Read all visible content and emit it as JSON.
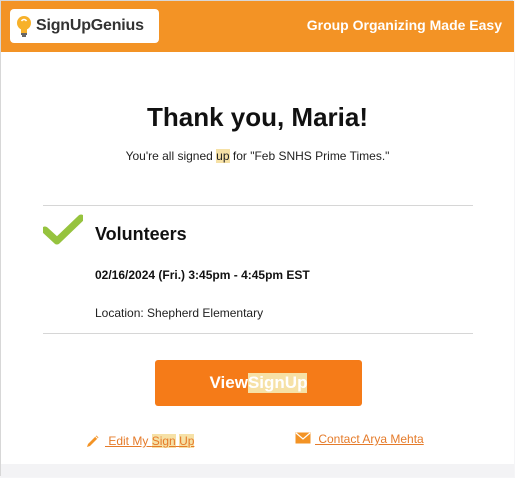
{
  "header": {
    "brand": "SignUpGenius",
    "tagline": "Group Organizing Made Easy"
  },
  "confirmation": {
    "title": "Thank you, Maria!",
    "subtitle_before": "You're all signed ",
    "subtitle_highlight": "up",
    "subtitle_after": " for \"Feb SNHS Prime Times.\""
  },
  "slot": {
    "name": "Volunteers",
    "datetime": "02/16/2024 (Fri.) 3:45pm - 4:45pm EST",
    "location": "Location: Shepherd Elementary"
  },
  "actions": {
    "view_prefix": "View ",
    "view_highlight_1": "Sign",
    "view_space": " ",
    "view_highlight_2": "Up",
    "edit_prefix": " Edit My ",
    "edit_highlight_1": "Sign",
    "edit_space": " ",
    "edit_highlight_2": "Up",
    "contact": " Contact Arya Mehta"
  },
  "colors": {
    "brand_orange": "#f39325",
    "button_orange": "#f57b18",
    "check_green": "#96c33e",
    "highlight": "#f6e1a6",
    "link": "#e57b2a"
  },
  "icons": {
    "logo": "lightbulb-icon",
    "status": "checkmark-icon",
    "edit": "pencil-icon",
    "contact": "envelope-icon"
  }
}
